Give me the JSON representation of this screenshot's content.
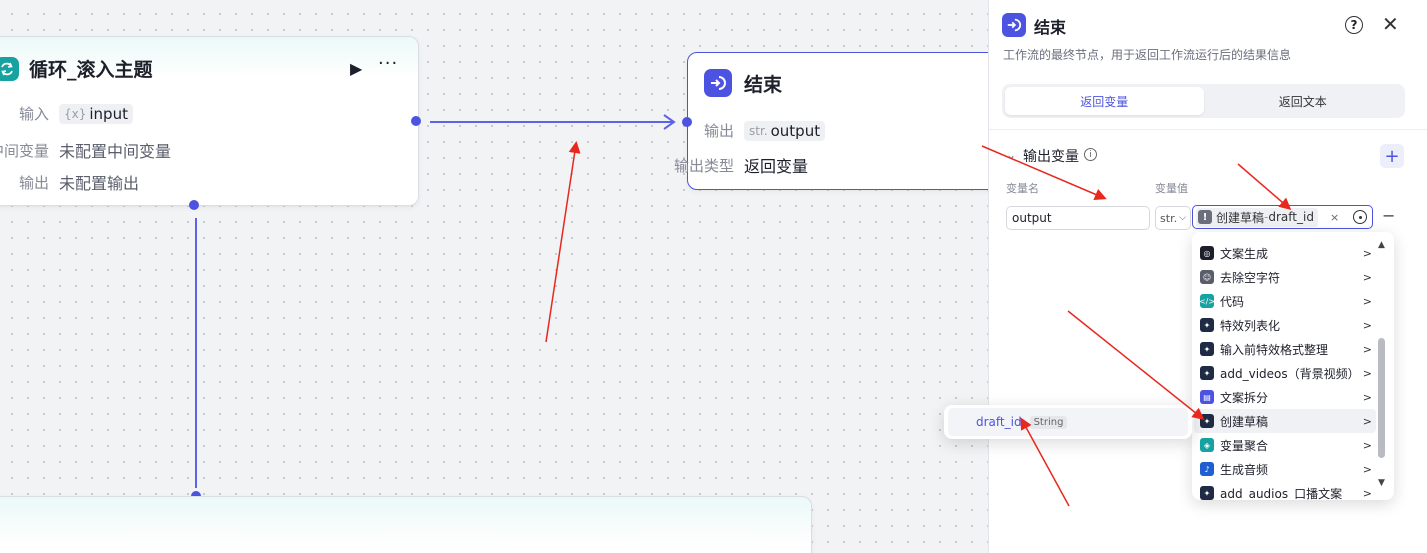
{
  "loop_node": {
    "title": "循环_滚入主题",
    "rows": [
      {
        "label": "输入",
        "type_tag": "{x}",
        "value": "input"
      },
      {
        "label": "中间变量",
        "value": "未配置中间变量"
      },
      {
        "label": "输出",
        "value": "未配置输出"
      }
    ]
  },
  "end_node": {
    "title": "结束",
    "output_label": "输出",
    "output_type_tag": "str.",
    "output_value": "output",
    "output_type_label": "输出类型",
    "output_type_value": "返回变量"
  },
  "panel": {
    "title": "结束",
    "description": "工作流的最终节点，用于返回工作流运行后的结果信息",
    "help_glyph": "?",
    "close_glyph": "✕",
    "tabs": [
      {
        "label": "返回变量",
        "active": true
      },
      {
        "label": "返回文本",
        "active": false
      }
    ],
    "section_title": "输出变量",
    "add_glyph": "+",
    "col_name": "变量名",
    "col_value": "变量值",
    "var_name_value": "output",
    "type_select": "str.",
    "ref_node": "创建草稿",
    "ref_var": "draft_id",
    "ref_sep": " - ",
    "remove_glyph": "−"
  },
  "dropdown": {
    "items": [
      {
        "label": "文案生成",
        "icon": "openai-icon",
        "color": "#1d1f2b"
      },
      {
        "label": "去除空字符",
        "icon": "robot-icon",
        "color": "#5a5d6b"
      },
      {
        "label": "代码",
        "icon": "code-icon",
        "color": "#17a2a2"
      },
      {
        "label": "特效列表化",
        "icon": "plugin-icon",
        "color": "#1f2a44"
      },
      {
        "label": "输入前特效格式整理",
        "icon": "plugin-icon",
        "color": "#1f2a44"
      },
      {
        "label": "add_videos（背景视频）",
        "icon": "plugin-icon",
        "color": "#1f2a44"
      },
      {
        "label": "文案拆分",
        "icon": "split-icon",
        "color": "#4c53e0"
      },
      {
        "label": "创建草稿",
        "icon": "plugin-icon",
        "color": "#1f2a44",
        "hover": true
      },
      {
        "label": "变量聚合",
        "icon": "merge-icon",
        "color": "#17a2a2"
      },
      {
        "label": "生成音频",
        "icon": "audio-icon",
        "color": "#1f5fd0"
      },
      {
        "label": "add_audios_口播文案",
        "icon": "plugin-icon",
        "color": "#1f2a44"
      }
    ]
  },
  "subpopup": {
    "name": "draft_id",
    "type": "String"
  },
  "colors": {
    "accent": "#4c53e0",
    "annotation": "#e8281e",
    "teal": "#17a2a2"
  }
}
